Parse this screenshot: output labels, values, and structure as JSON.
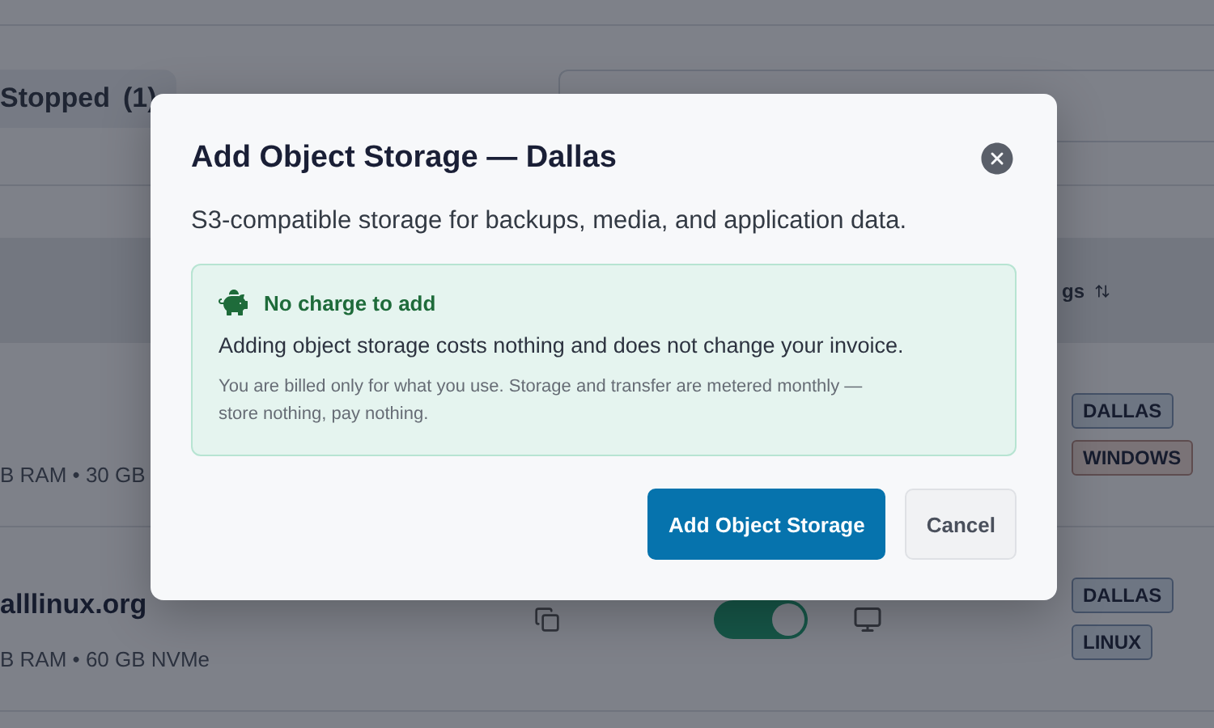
{
  "filter_tab": {
    "label": "Stopped",
    "count": "(1)"
  },
  "table": {
    "column_header": "gs",
    "rows": [
      {
        "domain": "",
        "specs": "B RAM • 30 GB",
        "toggle_on": null,
        "tags": [
          "DALLAS",
          "WINDOWS"
        ]
      },
      {
        "domain": "alllinux.org",
        "specs": "B RAM • 60 GB NVMe",
        "toggle_on": true,
        "tags": [
          "DALLAS",
          "LINUX"
        ]
      }
    ]
  },
  "dialog": {
    "title": "Add Object Storage — Dallas",
    "description": "S3-compatible storage for backups, media, and application data.",
    "notice": {
      "heading": "No charge to add",
      "body": "Adding object storage costs nothing and does not change your invoice.",
      "note": "You are billed only for what you use. Storage and transfer are metered monthly — store nothing, pay nothing."
    },
    "buttons": [
      {
        "label": "Add Object Storage",
        "kind": "primary"
      },
      {
        "label": "Cancel",
        "kind": "secondary"
      }
    ]
  }
}
